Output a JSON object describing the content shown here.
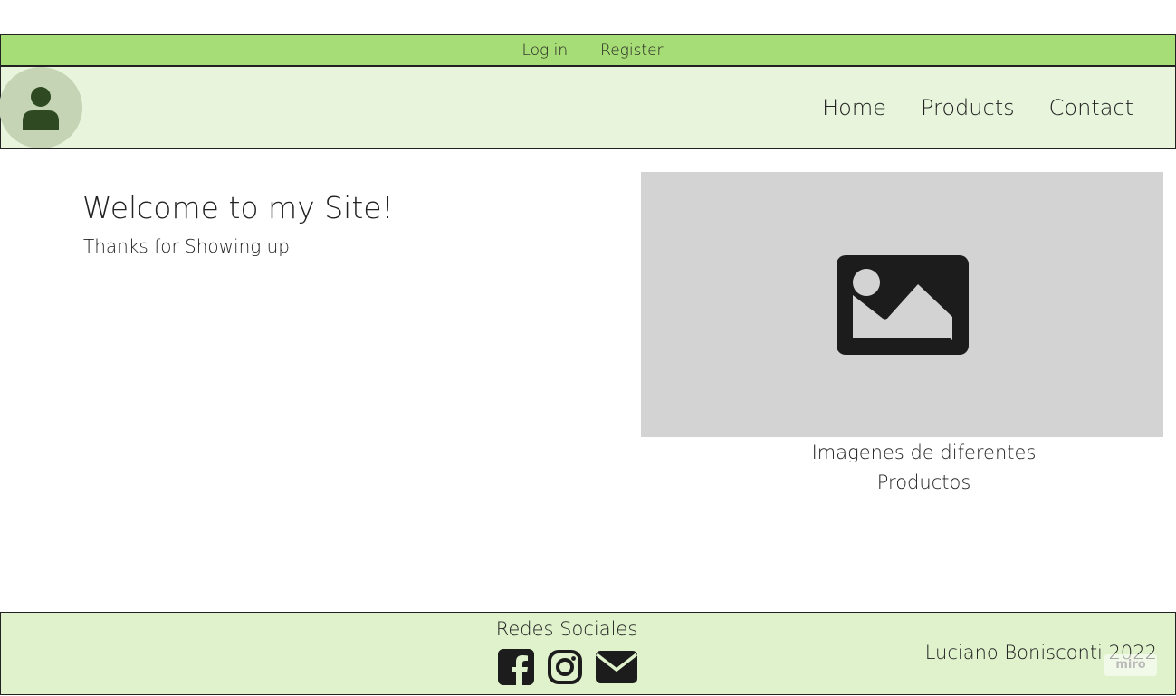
{
  "auth_bar": {
    "login_label": "Log in",
    "register_label": "Register"
  },
  "header": {
    "avatar_icon": "user-icon",
    "nav": {
      "home": "Home",
      "products": "Products",
      "contact": "Contact"
    }
  },
  "main": {
    "title": "Welcome to my Site!",
    "subtitle": "Thanks for Showing up",
    "image_icon": "image-placeholder-icon",
    "image_caption": "Imagenes de diferentes Productos"
  },
  "footer": {
    "social_title": "Redes Sociales",
    "social_icons": [
      "facebook-icon",
      "instagram-icon",
      "mail-icon"
    ],
    "copyright": "Luciano Bonisconti 2022",
    "badge": "miro"
  },
  "colors": {
    "auth_bar_bg": "#a7dd76",
    "header_bg": "#e8f5dc",
    "footer_bg": "#dff2cc",
    "avatar_bg": "#c4d4b4",
    "avatar_fg": "#2f4a22",
    "image_bg": "#d3d3d3"
  }
}
